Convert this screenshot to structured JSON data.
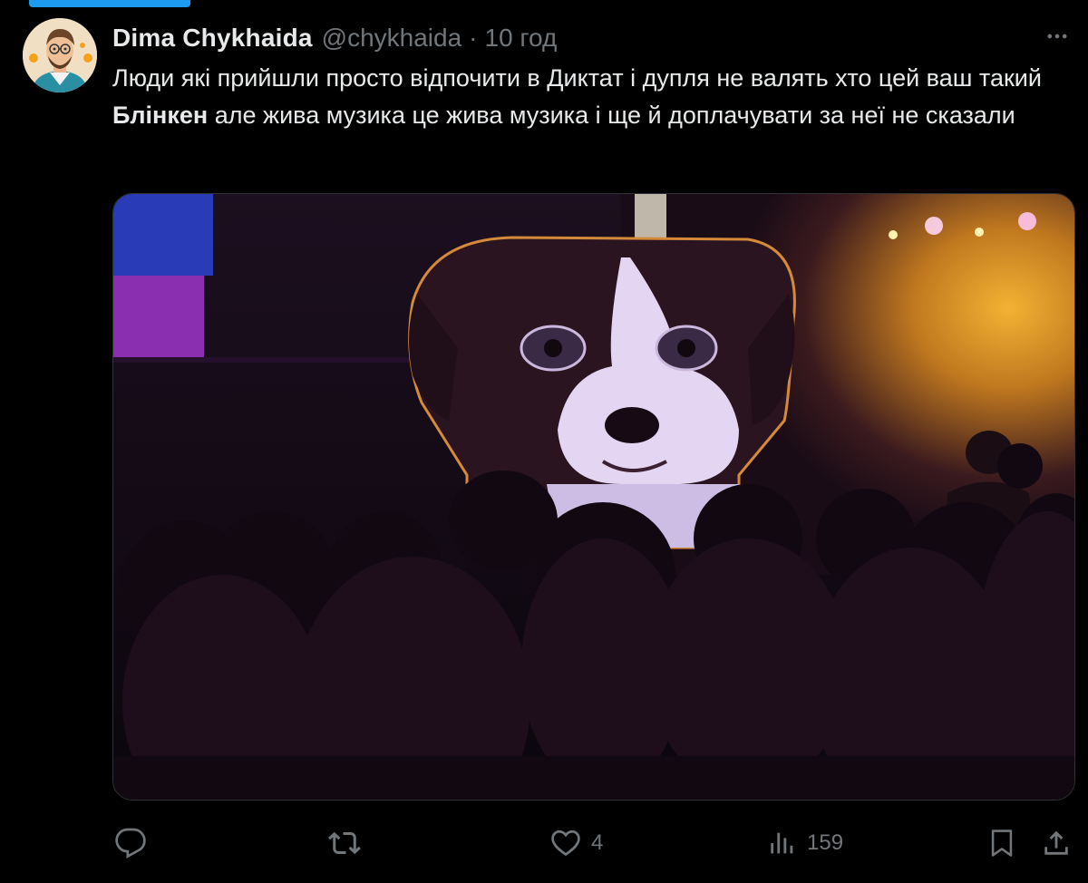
{
  "tweet": {
    "author_name": "Dima Chykhaida",
    "author_handle": "@chykhaida",
    "separator": "·",
    "time": "10 год",
    "text_part1": "Люди які прийшли просто відпочити в Диктат і дупля не валять хто цей ваш такий ",
    "text_bold": "Блінкен",
    "text_part2": " але жива музика це жива музика і ще й доплачувати за неї не сказали"
  },
  "media": {
    "alt": ""
  },
  "actions": {
    "reply_count": "",
    "retweet_count": "",
    "like_count": "4",
    "views_count": "159"
  },
  "icons": {
    "more": "more-icon",
    "reply": "reply-icon",
    "retweet": "retweet-icon",
    "like": "heart-icon",
    "views": "views-icon",
    "bookmark": "bookmark-icon",
    "share": "share-icon"
  },
  "colors": {
    "background": "#000000",
    "text": "#e7e9ea",
    "muted": "#71767b",
    "accent": "#1d9bf0"
  }
}
